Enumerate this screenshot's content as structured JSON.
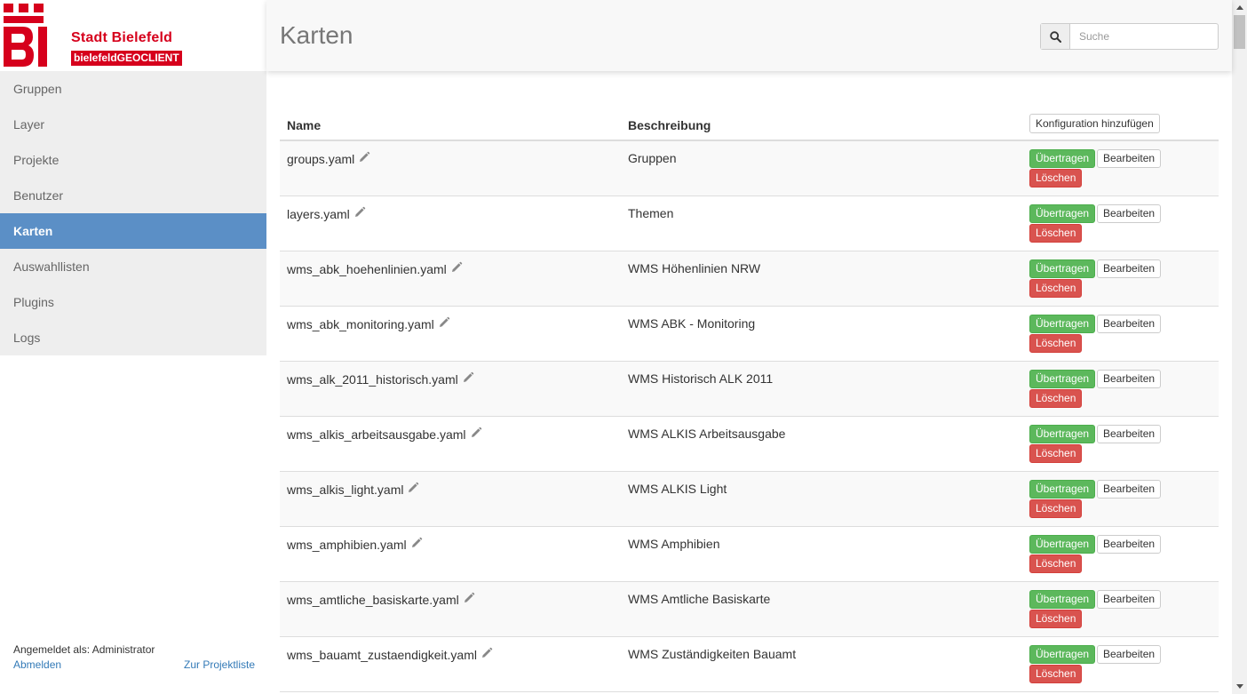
{
  "brand": {
    "city": "Stadt Bielefeld",
    "product": "bielefeldGEOCLIENT",
    "logo_letters": "BI",
    "brand_color": "#d6001c"
  },
  "sidebar": {
    "items": [
      {
        "label": "Gruppen",
        "active": false
      },
      {
        "label": "Layer",
        "active": false
      },
      {
        "label": "Projekte",
        "active": false
      },
      {
        "label": "Benutzer",
        "active": false
      },
      {
        "label": "Karten",
        "active": true
      },
      {
        "label": "Auswahllisten",
        "active": false
      },
      {
        "label": "Plugins",
        "active": false
      },
      {
        "label": "Logs",
        "active": false
      }
    ],
    "active_color": "#5b8fc6",
    "login_info": "Angemeldet als: Administrator",
    "logout_label": "Abmelden",
    "projects_link_label": "Zur Projektliste"
  },
  "header": {
    "title": "Karten",
    "search": {
      "placeholder": "Suche",
      "value": "",
      "icon": "search-icon"
    }
  },
  "table": {
    "columns": {
      "name": "Name",
      "description": "Beschreibung"
    },
    "add_button_label": "Konfiguration hinzufügen",
    "row_actions": {
      "transfer": "Übertragen",
      "edit": "Bearbeiten",
      "delete": "Löschen"
    },
    "rows": [
      {
        "name": "groups.yaml",
        "description": "Gruppen"
      },
      {
        "name": "layers.yaml",
        "description": "Themen"
      },
      {
        "name": "wms_abk_hoehenlinien.yaml",
        "description": "WMS Höhenlinien NRW"
      },
      {
        "name": "wms_abk_monitoring.yaml",
        "description": "WMS ABK - Monitoring"
      },
      {
        "name": "wms_alk_2011_historisch.yaml",
        "description": "WMS Historisch ALK 2011"
      },
      {
        "name": "wms_alkis_arbeitsausgabe.yaml",
        "description": "WMS ALKIS Arbeitsausgabe"
      },
      {
        "name": "wms_alkis_light.yaml",
        "description": "WMS ALKIS Light"
      },
      {
        "name": "wms_amphibien.yaml",
        "description": "WMS Amphibien"
      },
      {
        "name": "wms_amtliche_basiskarte.yaml",
        "description": "WMS Amtliche Basiskarte"
      },
      {
        "name": "wms_bauamt_zustaendigkeit.yaml",
        "description": "WMS Zuständigkeiten Bauamt"
      }
    ]
  }
}
